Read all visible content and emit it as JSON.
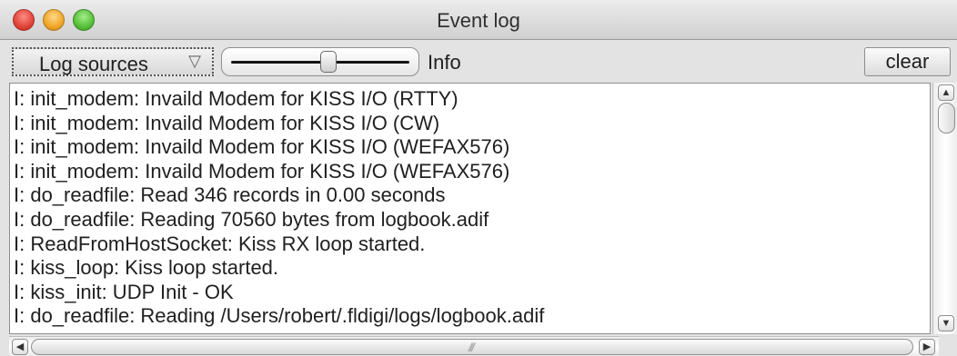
{
  "window": {
    "title": "Event log"
  },
  "toolbar": {
    "log_sources_label": "Log sources",
    "dropdown_glyph": "▽",
    "slider_label": "Info",
    "slider_level": 0.55,
    "clear_label": "clear"
  },
  "log": {
    "lines": [
      "I: init_modem: Invaild Modem for KISS I/O (RTTY)",
      "I: init_modem: Invaild Modem for KISS I/O (CW)",
      "I: init_modem: Invaild Modem for KISS I/O (WEFAX576)",
      "I: init_modem: Invaild Modem for KISS I/O (WEFAX576)",
      "I: do_readfile: Read 346 records in 0.00 seconds",
      "I: do_readfile: Reading 70560 bytes from logbook.adif",
      "I: ReadFromHostSocket: Kiss RX loop started.",
      "I: kiss_loop: Kiss loop started.",
      "I: kiss_init: UDP Init - OK",
      "I: do_readfile: Reading /Users/robert/.fldigi/logs/logbook.adif"
    ]
  },
  "scrollbars": {
    "up_glyph": "▲",
    "down_glyph": "▼",
    "left_glyph": "◀",
    "right_glyph": "▶",
    "grip_glyph": "///"
  }
}
